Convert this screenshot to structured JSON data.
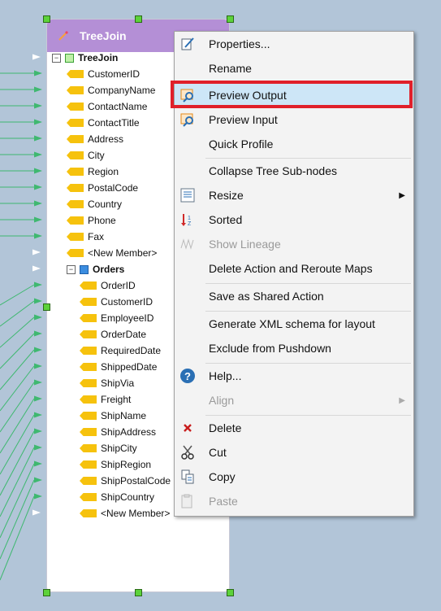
{
  "node": {
    "title": "TreeJoin",
    "root_label": "TreeJoin",
    "fields": [
      "CustomerID",
      "CompanyName",
      "ContactName",
      "ContactTitle",
      "Address",
      "City",
      "Region",
      "PostalCode",
      "Country",
      "Phone",
      "Fax",
      "<New Member>"
    ],
    "child_label": "Orders",
    "child_fields": [
      "OrderID",
      "CustomerID",
      "EmployeeID",
      "OrderDate",
      "RequiredDate",
      "ShippedDate",
      "ShipVia",
      "Freight",
      "ShipName",
      "ShipAddress",
      "ShipCity",
      "ShipRegion",
      "ShipPostalCode",
      "ShipCountry",
      "<New Member>"
    ]
  },
  "menu": {
    "items": [
      {
        "label": "Properties...",
        "icon": "properties-icon"
      },
      {
        "label": "Rename"
      },
      {
        "label": "Preview Output",
        "icon": "preview-output-icon",
        "selected": true
      },
      {
        "label": "Preview Input",
        "icon": "preview-input-icon"
      },
      {
        "label": "Quick Profile"
      },
      {
        "label": "Collapse Tree Sub-nodes"
      },
      {
        "label": "Resize",
        "icon": "resize-icon",
        "submenu": true
      },
      {
        "label": "Sorted",
        "icon": "sort-icon"
      },
      {
        "label": "Show Lineage",
        "icon": "lineage-icon",
        "disabled": true
      },
      {
        "label": "Delete Action and Reroute Maps"
      },
      {
        "label": "Save as Shared Action"
      },
      {
        "label": "Generate XML schema for layout"
      },
      {
        "label": "Exclude from Pushdown"
      },
      {
        "label": "Help...",
        "icon": "help-icon"
      },
      {
        "label": "Align",
        "disabled": true,
        "submenu": true
      },
      {
        "label": "Delete",
        "icon": "delete-icon"
      },
      {
        "label": "Cut",
        "icon": "cut-icon"
      },
      {
        "label": "Copy",
        "icon": "copy-icon"
      },
      {
        "label": "Paste",
        "icon": "paste-icon",
        "disabled": true
      }
    ]
  },
  "colors": {
    "header": "#b48fd6",
    "highlight": "#cde6f7",
    "callout": "#e0202a",
    "connector": "#3fb870",
    "tag": "#f6c20d"
  }
}
